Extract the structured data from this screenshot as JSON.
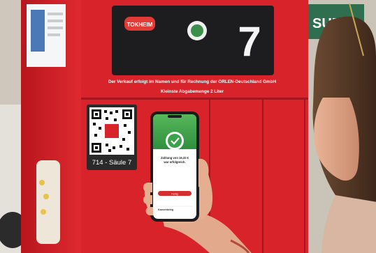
{
  "photo": {
    "pump_brand": "TOKHEIM",
    "pump_number": "7",
    "pump_notice_line1": "Der Verkauf erfolgt im Namen und für Rechnung der ORLEN-Deutschland GmbH",
    "pump_notice_line2": "Kleinste Abgabemenge 2 Liter",
    "qr_label": "714 - Säule 7",
    "background_sign": "SUP",
    "phone": {
      "message_line1": "Zahlung von 16,32 €",
      "message_line2": "war erfolgreich.",
      "button_label": "Fertig",
      "footer_text": "Kassenbeleg"
    }
  },
  "colors": {
    "pump_red": "#d8232a",
    "pump_dark_red": "#a5151b",
    "app_green": "#3aa34a",
    "app_button_red": "#d32f2f"
  }
}
